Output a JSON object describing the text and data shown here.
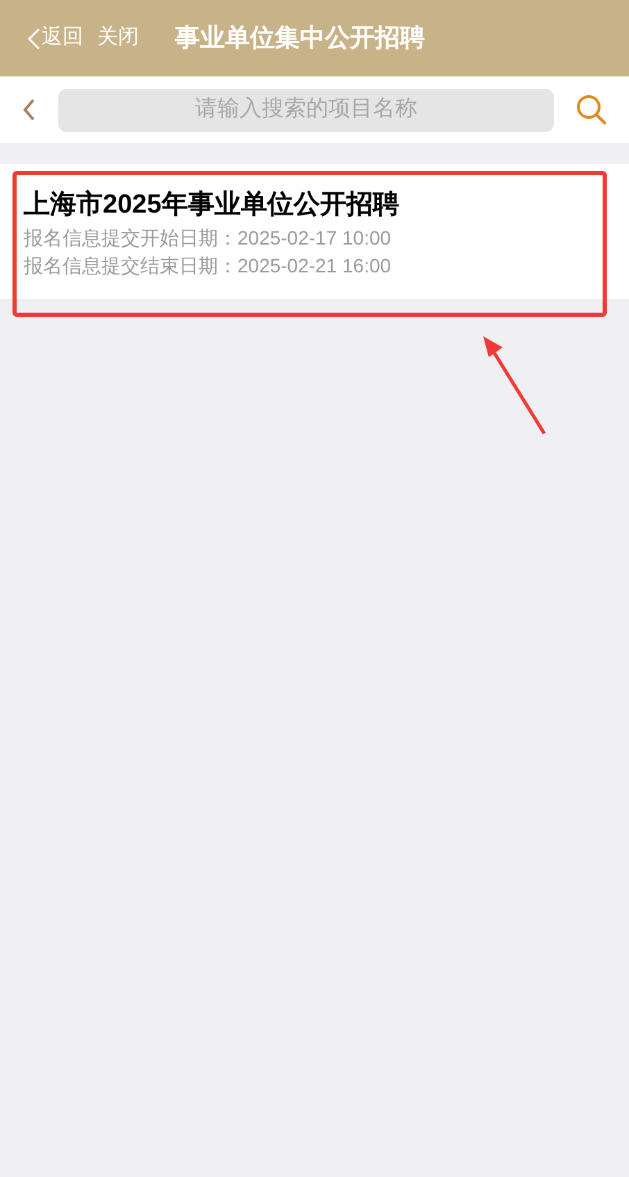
{
  "header": {
    "back": "返回",
    "close": "关闭",
    "title": "事业单位集中公开招聘"
  },
  "search": {
    "placeholder": "请输入搜索的项目名称"
  },
  "items": [
    {
      "title": "上海市2025年事业单位公开招聘",
      "lines": [
        "报名信息提交开始日期：2025-02-17 10:00",
        "报名信息提交结束日期：2025-02-21 16:00"
      ]
    }
  ]
}
